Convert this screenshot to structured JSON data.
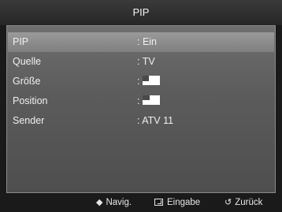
{
  "title": "PIP",
  "menu": {
    "items": [
      {
        "label": "PIP",
        "value": ": Ein"
      },
      {
        "label": "Quelle",
        "value": ": TV"
      },
      {
        "label": "Größe",
        "value": ":"
      },
      {
        "label": "Position",
        "value": ":"
      },
      {
        "label": "Sender",
        "value": ": ATV 11"
      }
    ]
  },
  "footer": {
    "navigate_glyph": "◆",
    "navigate_label": "Navig.",
    "enter_label": "Eingabe",
    "return_glyph": "↺",
    "return_label": "Zurück"
  },
  "colors": {
    "background": "#1a1a1a",
    "panel": "#5c5c5c",
    "selected": "#8a8a8a"
  }
}
